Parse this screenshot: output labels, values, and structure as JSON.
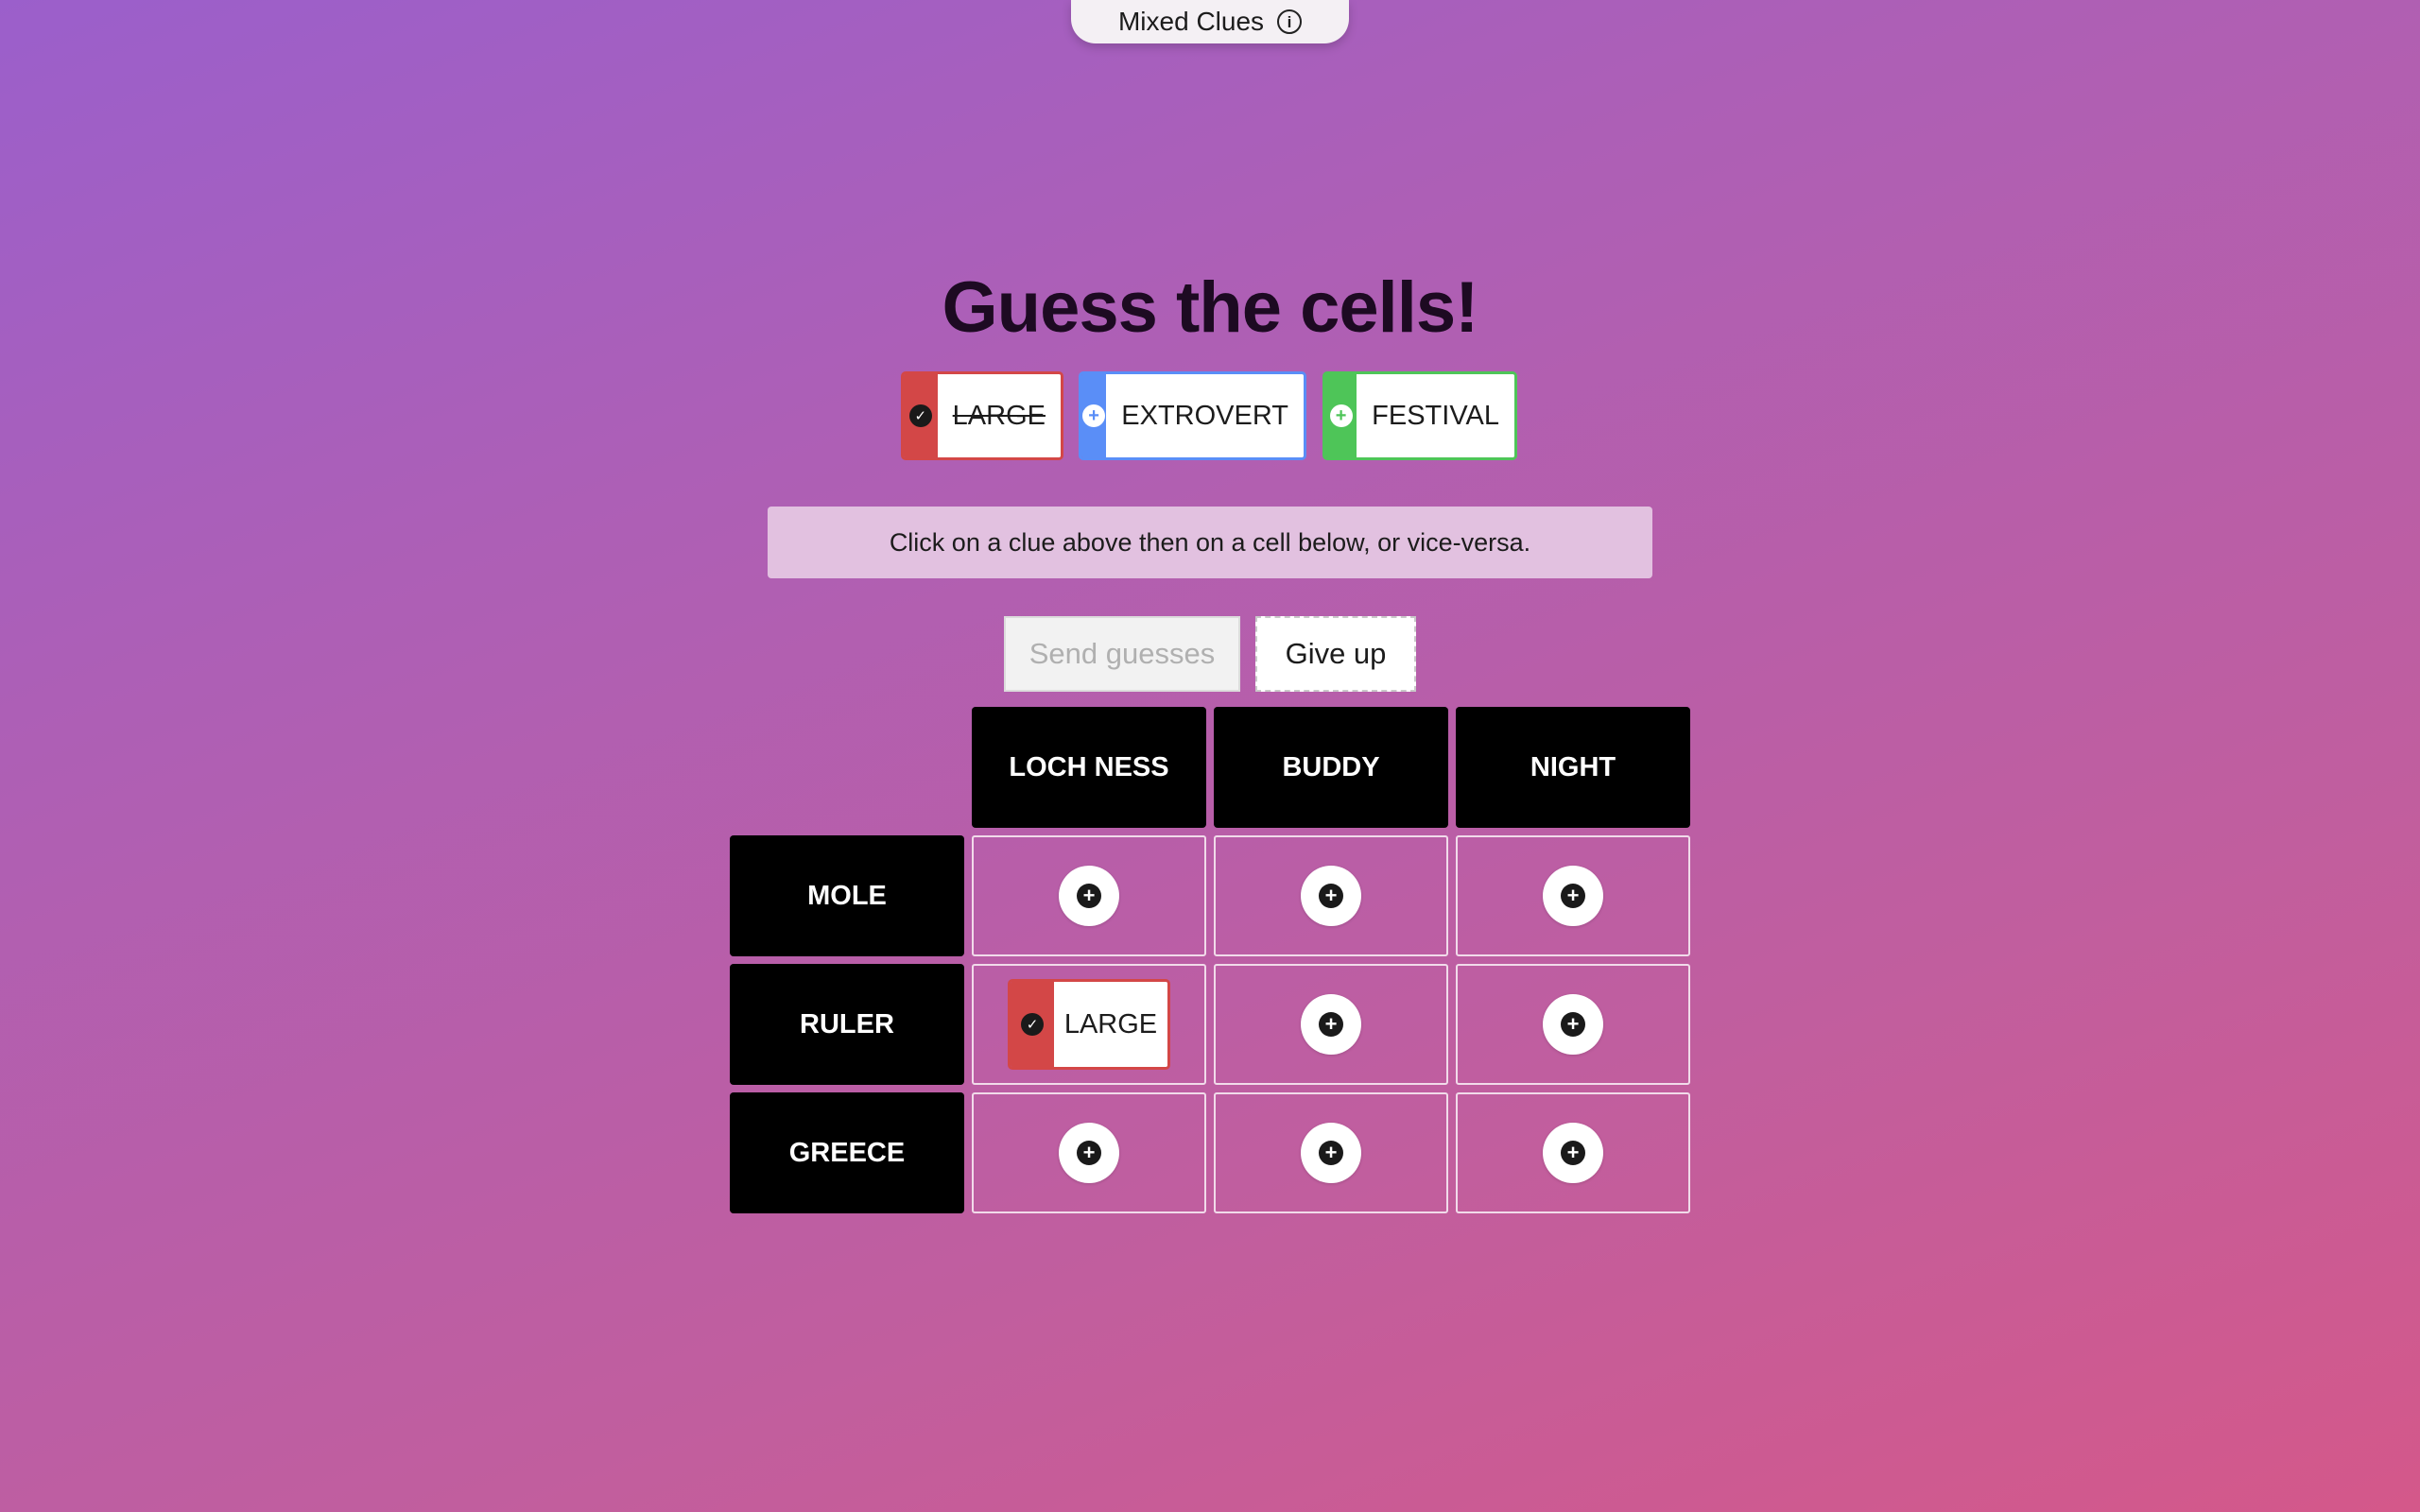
{
  "top_tab": {
    "label": "Mixed Clues",
    "info_icon": "info-icon"
  },
  "title": "Guess the cells!",
  "clues": [
    {
      "label": "LARGE",
      "color": "#d34747",
      "state": "placed",
      "icon": "check-icon"
    },
    {
      "label": "EXTROVERT",
      "color": "#5a8ef7",
      "state": "available",
      "icon": "plus-icon"
    },
    {
      "label": "FESTIVAL",
      "color": "#4ec558",
      "state": "available",
      "icon": "plus-icon"
    }
  ],
  "hint": "Click on a clue above then on a cell below, or vice-versa.",
  "buttons": {
    "send": "Send guesses",
    "give_up": "Give up"
  },
  "grid": {
    "columns": [
      "LOCH NESS",
      "BUDDY",
      "NIGHT"
    ],
    "rows": [
      "MOLE",
      "RULER",
      "GREECE"
    ],
    "cells": [
      [
        null,
        null,
        null
      ],
      [
        "LARGE",
        null,
        null
      ],
      [
        null,
        null,
        null
      ]
    ]
  },
  "colors": {
    "placed_clue": "#d34747",
    "header_bg": "#000000"
  }
}
